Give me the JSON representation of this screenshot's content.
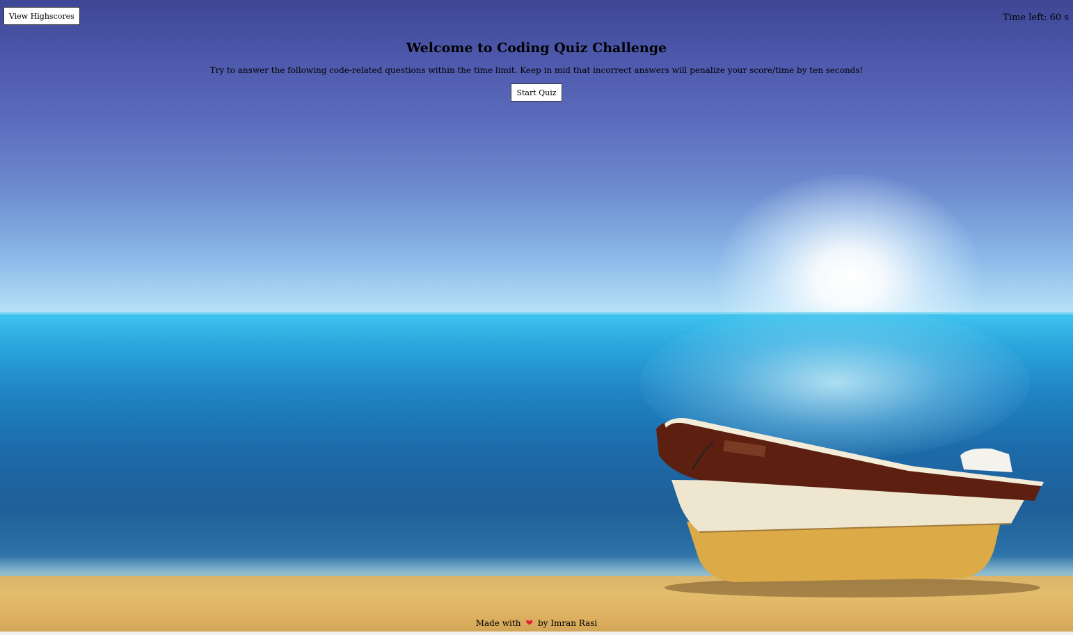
{
  "header": {
    "highscores_label": "View Highscores",
    "timer_text": "Time left: 60 s"
  },
  "main": {
    "title": "Welcome to Coding Quiz Challenge",
    "description": "Try to answer the following code-related questions within the time limit. Keep in mid that incorrect answers will penalize your score/time by ten seconds!",
    "start_label": "Start Quiz"
  },
  "footer": {
    "made_with": "Made with",
    "heart_icon": "heart-icon",
    "author": "by Imran Rasi"
  },
  "colors": {
    "heart": "#e5233a",
    "button_bg": "#ffffff",
    "text": "#000000"
  }
}
